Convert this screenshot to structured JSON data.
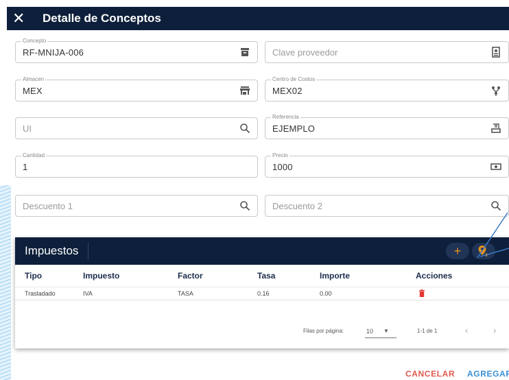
{
  "dialog": {
    "title": "Detalle de Conceptos"
  },
  "fields": {
    "concepto": {
      "label": "Concepto",
      "value": "RF-MNIJA-006"
    },
    "clave_proveedor": {
      "placeholder": "Clave proveedor"
    },
    "almacen": {
      "label": "Almacen",
      "value": "MEX"
    },
    "centro_costos": {
      "label": "Centro de Costos",
      "value": "MEX02"
    },
    "ui": {
      "placeholder": "UI"
    },
    "referencia": {
      "label": "Referencia",
      "value": "EJEMPLO"
    },
    "cantidad": {
      "label": "Cantidad",
      "value": "1"
    },
    "precio": {
      "label": "Precio",
      "value": "1000"
    },
    "descuento1": {
      "placeholder": "Descuento 1"
    },
    "descuento2": {
      "placeholder": "Descuento 2"
    }
  },
  "impuestos": {
    "title": "Impuestos",
    "add_label": "+",
    "columns": [
      "Tipo",
      "Impuesto",
      "Factor",
      "Tasa",
      "Importe",
      "Acciones"
    ],
    "rows": [
      {
        "tipo": "Trasladado",
        "impuesto": "IVA",
        "factor": "TASA",
        "tasa": "0.16",
        "importe": "0.00"
      }
    ],
    "pager": {
      "rows_label": "Filas por página:",
      "rows_value": "10",
      "range": "1-1 de 1",
      "prev": "‹",
      "next": "›"
    }
  },
  "buttons": {
    "cancel": "CANCELAR",
    "add": "AGREGAR"
  },
  "colors": {
    "header": "#0d1f3a",
    "accent_orange": "#e6921e",
    "cancel": "#e05a4f",
    "primary": "#3a8fd6",
    "delete": "#e53935"
  },
  "icons": {
    "close": "close-icon",
    "concepto": "archive-icon",
    "proveedor": "badge-icon",
    "almacen": "store-icon",
    "costos": "network-icon",
    "search": "search-icon",
    "referencia": "receipt-icon",
    "precio": "cash-icon",
    "delete": "trash-icon",
    "location": "location-add-icon"
  }
}
